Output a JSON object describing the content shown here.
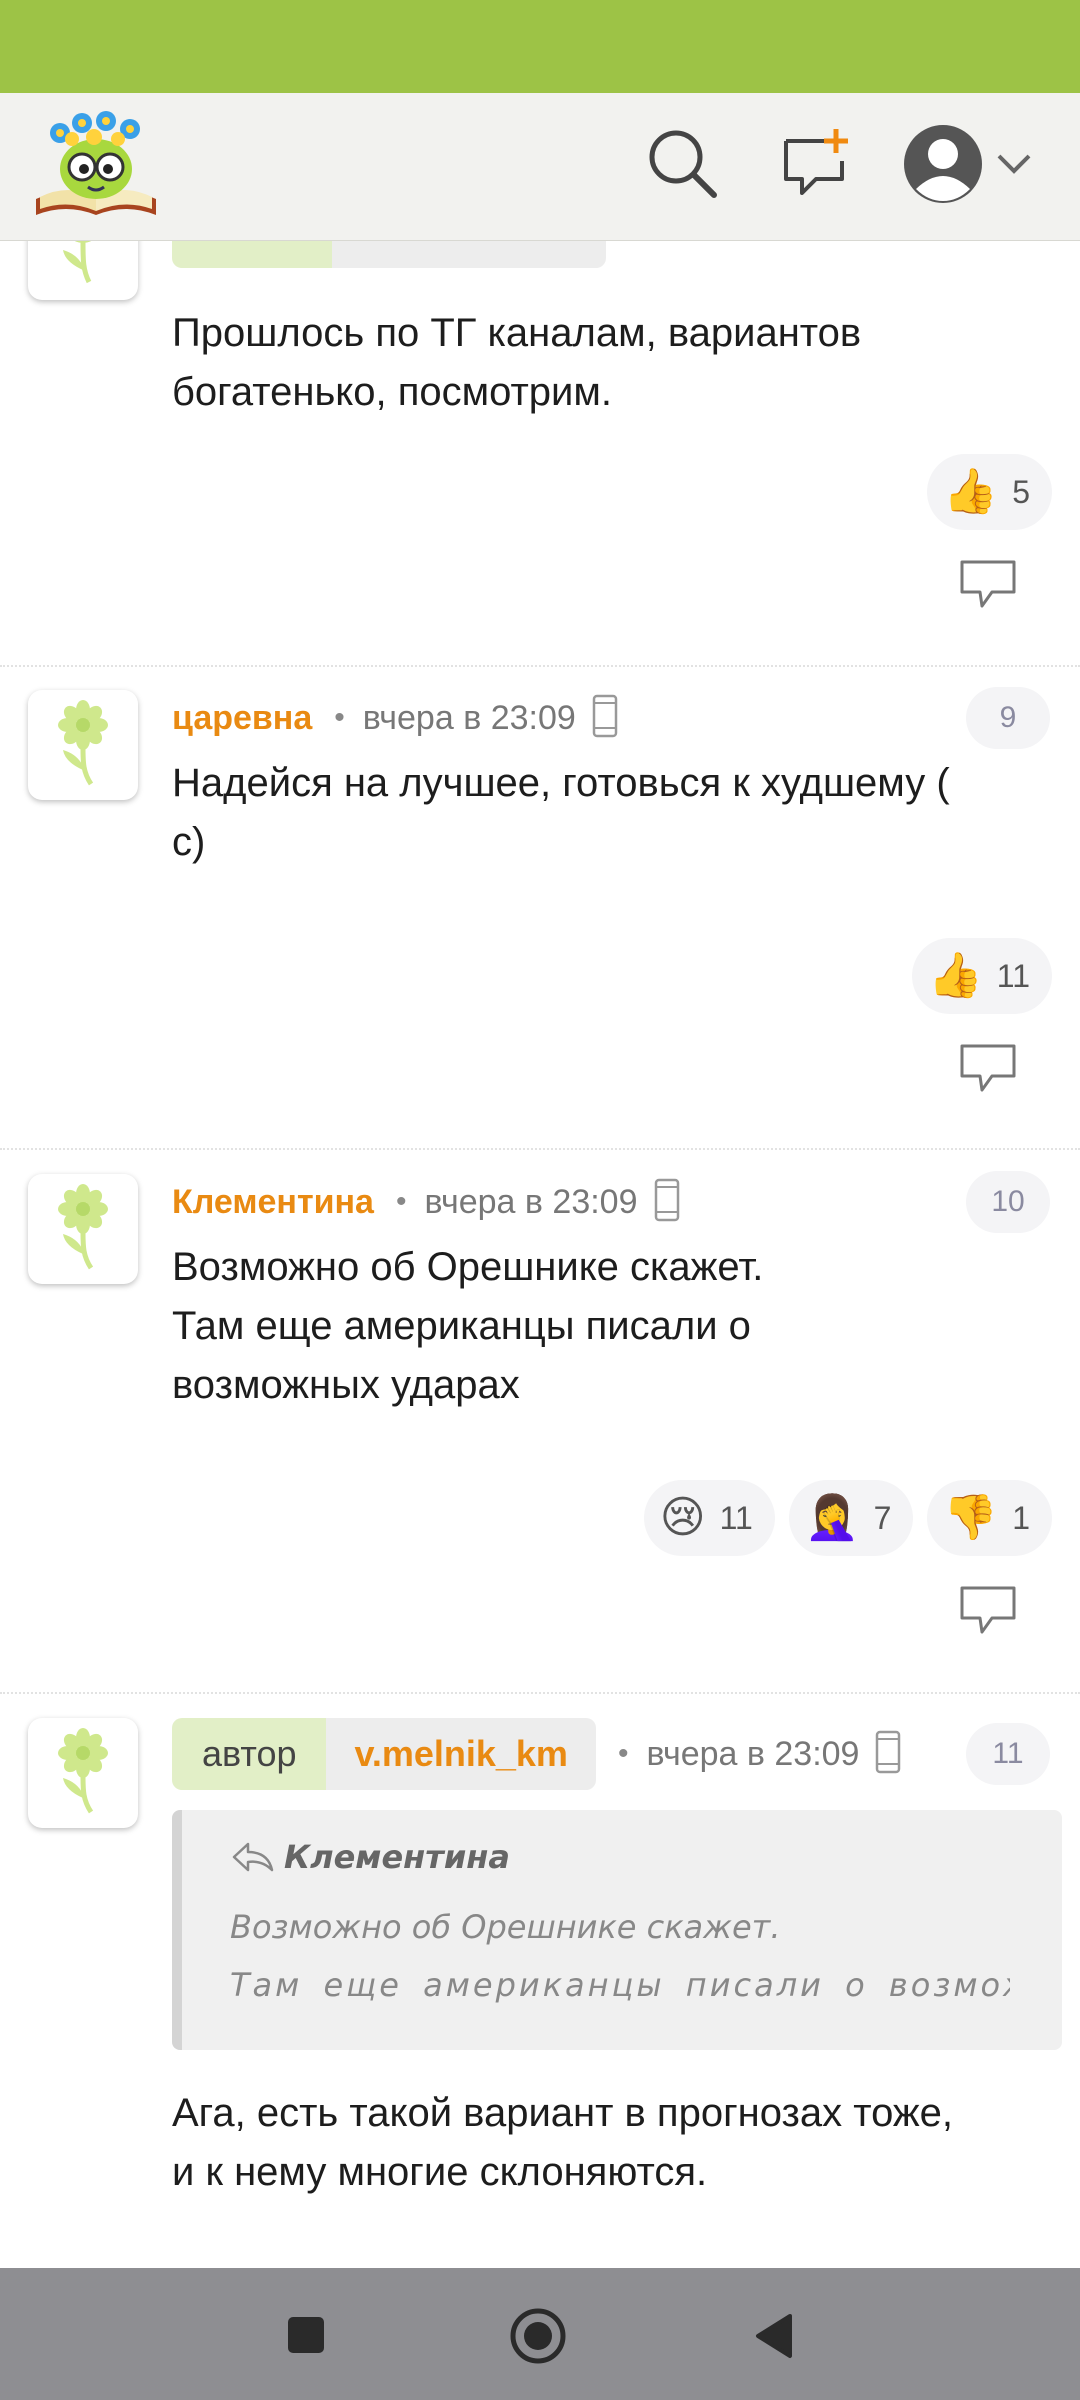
{
  "app": {
    "icons": {
      "logo": "bookworm-logo-icon",
      "search": "search-icon",
      "new_message": "new-message-icon",
      "profile": "profile-avatar-icon",
      "dropdown": "chevron-down-icon"
    }
  },
  "comments": [
    {
      "text_lines": [
        "Прошлось по ТГ каналам, вариантов",
        "богатенько, посмотрим."
      ],
      "reactions": [
        {
          "emoji": "👍",
          "count": "5"
        }
      ]
    },
    {
      "author": "царевна",
      "time": "вчера в 23:09",
      "number": "9",
      "text_lines": [
        "Надейся на лучшее, готовься к худшему (",
        "с)"
      ],
      "reactions": [
        {
          "emoji": "👍",
          "count": "11"
        }
      ]
    },
    {
      "author": "Клементина",
      "time": "вчера в 23:09",
      "number": "10",
      "text_lines": [
        "Возможно об Орешнике скажет.",
        "Там еще американцы писали о",
        "возможных ударах"
      ],
      "reactions": [
        {
          "emoji": "😢",
          "count": "11"
        },
        {
          "emoji": "🤦‍♀️",
          "count": "7"
        },
        {
          "emoji": "👎",
          "count": "1"
        }
      ]
    },
    {
      "author_label": "автор",
      "author": "v.melnik_km",
      "time": "вчера в 23:09",
      "number": "11",
      "quote": {
        "author": "Клементина",
        "line1": "Возможно об Орешнике скажет.",
        "line2": "Там еще американцы писали о возможн…"
      },
      "text_lines": [
        "Ага, есть такой вариант в прогнозах тоже,",
        "и к нему многие склоняются."
      ]
    }
  ],
  "colors": {
    "status_bar": "#9dc346",
    "author": "#e98a12",
    "topbar": "#f2f2ef"
  }
}
